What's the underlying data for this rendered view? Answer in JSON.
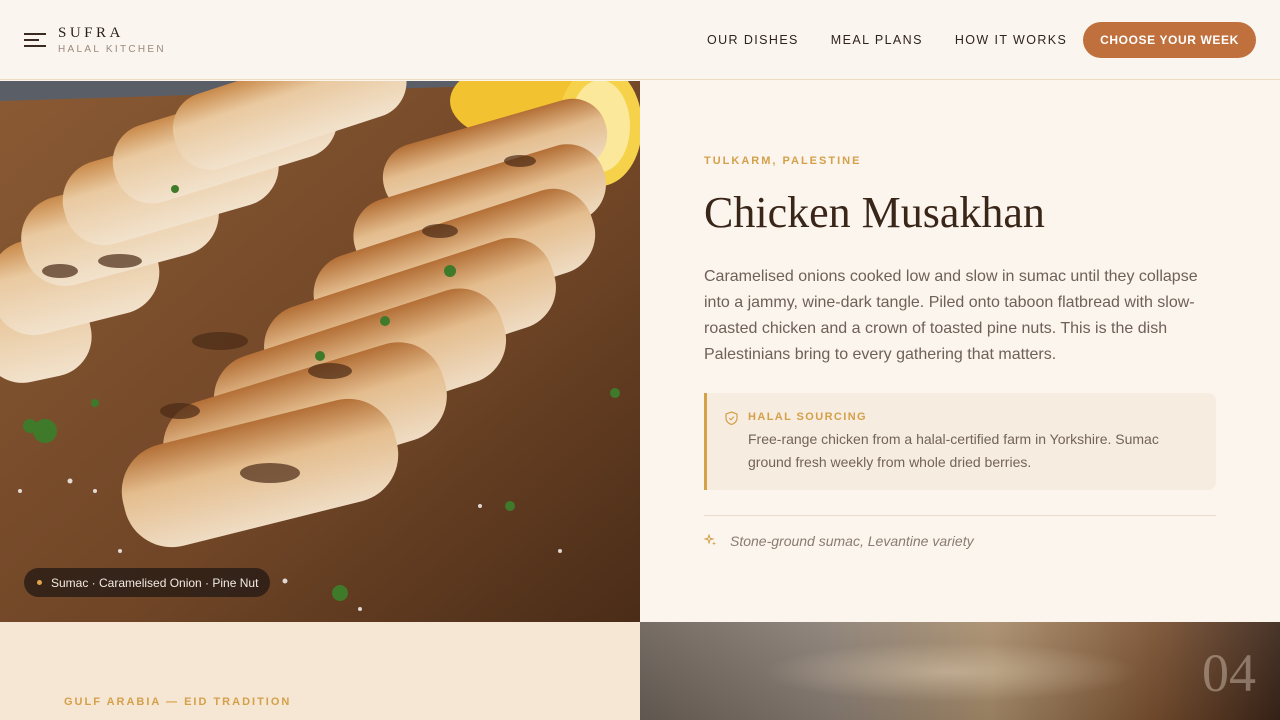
{
  "brand": {
    "name": "SUFRA",
    "tagline": "HALAL KITCHEN"
  },
  "nav": {
    "items": [
      {
        "label": "OUR DISHES"
      },
      {
        "label": "MEAL PLANS"
      },
      {
        "label": "HOW IT WORKS"
      }
    ],
    "cta_label": "CHOOSE YOUR WEEK"
  },
  "hero": {
    "image_subject": "sliced grilled chicken breast on wooden board with lemon and parsley",
    "ingredients_pill": "Sumac · Caramelised Onion · Pine Nut"
  },
  "dish": {
    "origin": "TULKARM, PALESTINE",
    "title": "Chicken Musakhan",
    "description": "Caramelised onions cooked low and slow in sumac until they collapse into a jammy, wine-dark tangle. Piled onto taboon flatbread with slow-roasted chicken and a crown of toasted pine nuts. This is the dish Palestinians bring to every gathering that matters.",
    "sourcing": {
      "title": "HALAL SOURCING",
      "text": "Free-range chicken from a halal-certified farm in Yorkshire. Sumac ground fresh weekly from whole dried berries."
    },
    "spice_note": "Stone-ground sumac, Levantine variety"
  },
  "next_dish": {
    "origin": "GULF ARABIA — EID TRADITION",
    "index": "04"
  },
  "icons": {
    "menu": "menu-icon",
    "shield": "shield-icon",
    "sparkle": "sparkle-icon"
  },
  "colors": {
    "accent": "#c0703c",
    "gold": "#d4a04a",
    "title": "#3a2619",
    "background": "#fbf5ee"
  }
}
